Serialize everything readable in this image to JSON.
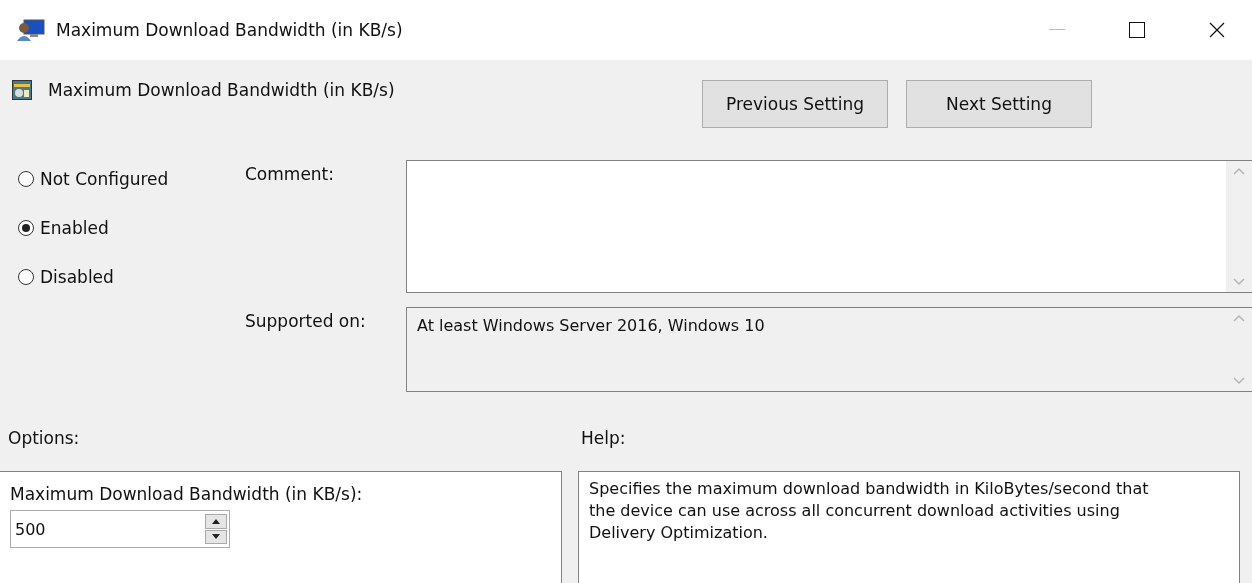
{
  "window": {
    "title": "Maximum Download Bandwidth (in KB/s)"
  },
  "header": {
    "title": "Maximum Download Bandwidth (in KB/s)"
  },
  "nav_buttons": [
    "Previous Setting",
    "Next Setting"
  ],
  "states": [
    {
      "label": "Not Configured",
      "selected": false
    },
    {
      "label": "Enabled",
      "selected": true
    },
    {
      "label": "Disabled",
      "selected": false
    }
  ],
  "comment": {
    "label": "Comment:"
  },
  "supported_on": {
    "label": "Supported on:",
    "value": "At least Windows Server 2016, Windows 10"
  },
  "options": {
    "label": "Options:",
    "field_label": "Maximum Download Bandwidth (in KB/s):",
    "value": "500"
  },
  "help": {
    "label": "Help:",
    "text": "Specifies the maximum download bandwidth in KiloBytes/second that the device can use across all concurrent download activities using Delivery Optimization."
  }
}
